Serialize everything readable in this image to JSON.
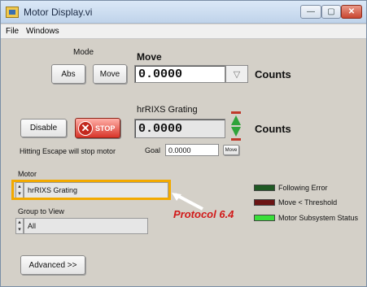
{
  "window": {
    "title": "Motor Display.vi",
    "minimize_glyph": "—",
    "maximize_glyph": "▢",
    "close_glyph": "✕"
  },
  "menu": {
    "items": [
      "File",
      "Windows"
    ]
  },
  "mode": {
    "label": "Mode",
    "abs_label": "Abs",
    "move_label": "Move"
  },
  "move": {
    "label": "Move",
    "value": "0.0000",
    "dropdown_glyph": "▽",
    "units": "Counts"
  },
  "controls": {
    "disable_label": "Disable",
    "stop_label": "STOP",
    "stop_glyph": "✕",
    "escape_hint": "Hitting Escape will stop motor"
  },
  "position": {
    "label": "hrRIXS Grating",
    "value": "0.0000",
    "units": "Counts"
  },
  "goal": {
    "label": "Goal",
    "value": "0.0000",
    "move_label": "Move"
  },
  "motor": {
    "label": "Motor",
    "value": "hrRIXS Grating"
  },
  "group": {
    "label": "Group to View",
    "value": "All"
  },
  "annotation": {
    "text": "Protocol 6.4",
    "color": "#d11a1a"
  },
  "indicators": [
    {
      "label": "Following Error",
      "color": "#1f5a24"
    },
    {
      "label": "Move < Threshold",
      "color": "#6b1414"
    },
    {
      "label": "Motor Subsystem Status",
      "color": "#3adf3a"
    }
  ],
  "advanced": {
    "label": "Advanced >>"
  },
  "colors": {
    "panel": "#d4d0c8",
    "highlight": "#f2a900",
    "stop": "#d8352a",
    "spinner": "#2fa33a"
  }
}
